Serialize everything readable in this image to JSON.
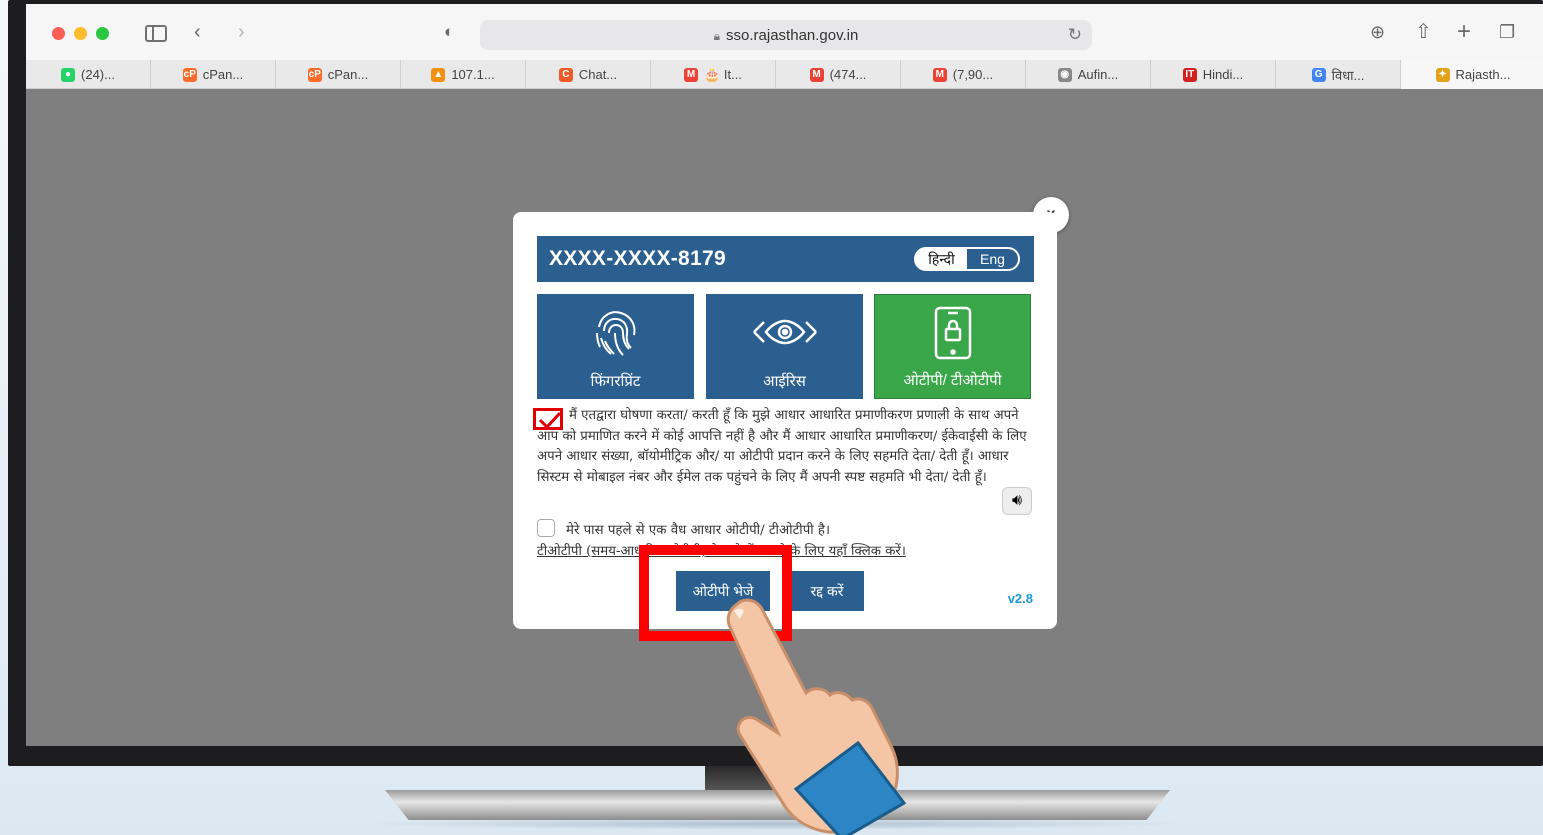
{
  "browser": {
    "url": "sso.rajasthan.gov.in",
    "tabs": [
      {
        "label": "(24)...",
        "icon": "whatsapp-icon",
        "color": "#25d366",
        "glyph": "●"
      },
      {
        "label": "cPan...",
        "icon": "cpanel-icon",
        "color": "#ff6c2c",
        "glyph": "cP"
      },
      {
        "label": "cPan...",
        "icon": "cpanel-icon",
        "color": "#ff6c2c",
        "glyph": "cP"
      },
      {
        "label": "107.1...",
        "icon": "pma-icon",
        "color": "#f29111",
        "glyph": "▲"
      },
      {
        "label": "Chat...",
        "icon": "chat-icon",
        "color": "#f05a28",
        "glyph": "C"
      },
      {
        "label": "🎂 It...",
        "icon": "gmail-icon",
        "color": "#ea4335",
        "glyph": "M"
      },
      {
        "label": "(474...",
        "icon": "gmail-icon",
        "color": "#ea4335",
        "glyph": "M"
      },
      {
        "label": "(7,90...",
        "icon": "gmail-icon",
        "color": "#ea4335",
        "glyph": "M"
      },
      {
        "label": "Aufin...",
        "icon": "site-icon",
        "color": "#888888",
        "glyph": "◉"
      },
      {
        "label": "Hindi...",
        "icon": "it-icon",
        "color": "#d02020",
        "glyph": "IT"
      },
      {
        "label": "विधा...",
        "icon": "google-icon",
        "color": "#4285f4",
        "glyph": "G"
      },
      {
        "label": "Rajasth...",
        "icon": "rajasthan-icon",
        "color": "#e3a21a",
        "glyph": "✦"
      }
    ]
  },
  "modal": {
    "aadhaar_masked": "XXXX-XXXX-8179",
    "lang_hindi": "हिन्दी",
    "lang_eng": "Eng",
    "close_label": "x",
    "options": {
      "fingerprint": "फिंगरप्रिंट",
      "iris": "आईरिस",
      "otp": "ओटीपी/ टीओटीपी"
    },
    "consent_text": "मैं एतद्वारा घोषणा करता/ करती हूँ कि मुझे आधार आधारित प्रमाणीकरण प्रणाली के साथ अपने आप को प्रमाणित करने में कोई आपत्ति नहीं है और मैं आधार आधारित प्रमाणीकरण/ ईकेवाईसी के लिए अपने आधार संख्या, बॉयोमीट्रिक और/ या ओटीपी प्रदान करने के लिए सहमति देता/ देती हूँ। आधार सिस्टम से मोबाइल नंबर और ईमेल तक पहुंचने के लिए मैं अपनी स्पष्ट सहमति भी देता/ देती हूँ।",
    "have_otp": "मेरे पास पहले से एक वैध आधार ओटीपी/ टीओटीपी है।",
    "totp_link": "टीओटीपी (समय-आधारित ओटीपी) के बारे में जानने के लिए यहाँ क्लिक करें।",
    "send_otp": "ओटीपी भेजे",
    "cancel": "रद्द करें",
    "version": "v2.8"
  }
}
